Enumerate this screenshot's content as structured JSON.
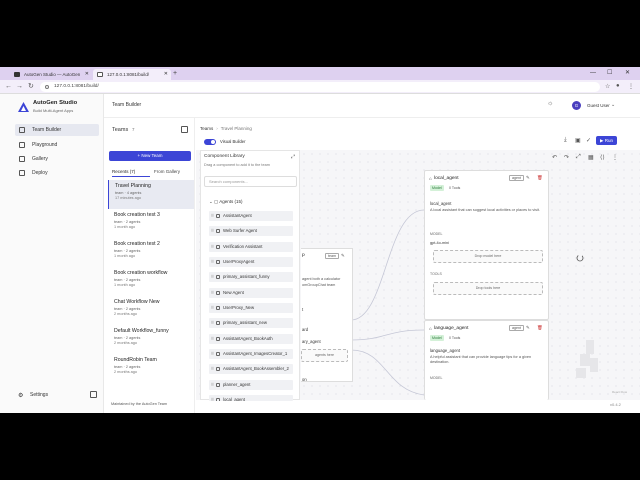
{
  "browser": {
    "tabs": [
      {
        "title": "AutoGen Studio — AutoGen",
        "active": false
      },
      {
        "title": "127.0.0.1:8081/build/",
        "active": true
      }
    ],
    "url": "127.0.0.1:8081/build/"
  },
  "brand": {
    "title": "AutoGen Studio",
    "subtitle": "Build Multi-Agent Apps"
  },
  "sidebar": {
    "items": [
      {
        "label": "Team Builder",
        "active": true
      },
      {
        "label": "Playground",
        "active": false
      },
      {
        "label": "Gallery",
        "active": false
      },
      {
        "label": "Deploy",
        "active": false
      }
    ],
    "settings_label": "Settings"
  },
  "header": {
    "title": "Team Builder",
    "user_name": "Guest User",
    "avatar_initial": "G"
  },
  "teams_panel": {
    "title": "Teams",
    "count": "7",
    "new_team_label": "+ New Team",
    "tab_recents": "Recents (7)",
    "tab_gallery": "From Gallery",
    "teams": [
      {
        "name": "Travel Planning",
        "meta": "team · 4 agents",
        "time": "17 minutes ago",
        "active": true
      },
      {
        "name": "Book creation test 3",
        "meta": "team · 2 agents",
        "time": "1 month ago",
        "active": false
      },
      {
        "name": "Book creation test 2",
        "meta": "team · 2 agents",
        "time": "1 month ago",
        "active": false
      },
      {
        "name": "Book creation workflow",
        "meta": "team · 2 agents",
        "time": "1 month ago",
        "active": false
      },
      {
        "name": "Chat Workflow New",
        "meta": "team · 2 agents",
        "time": "2 months ago",
        "active": false
      },
      {
        "name": "Default Workflow_funny",
        "meta": "team · 2 agents",
        "time": "2 months ago",
        "active": false
      },
      {
        "name": "RoundRobin Team",
        "meta": "team · 2 agents",
        "time": "2 months ago",
        "active": false
      }
    ]
  },
  "builder": {
    "crumb_root": "Teams",
    "crumb_current": "Travel Planning",
    "visual_builder_label": "Visual Builder",
    "run_label": "Run"
  },
  "library": {
    "title": "Component Library",
    "subtitle": "Drag a component to add it to the team",
    "search_placeholder": "Search components...",
    "agents_header": "Agents (15)",
    "agents": [
      "AssistantAgent",
      "Web Surfer Agent",
      "Verification Assistant",
      "UserProxyAgent",
      "primary_assistant_funny",
      "New Agent",
      "UserProxy_New",
      "primary_assistant_new",
      "AssistantAgent_BookAuth",
      "AssistantAgent_ImagesCreator_1",
      "AssistantAgent_BookAssembler_2",
      "planner_agent",
      "local_agent"
    ]
  },
  "nodes": {
    "partial": {
      "name_tail": "p",
      "type": "team",
      "desc": "agent both a calculator",
      "desc2": "omGroupChat team",
      "row1": "t",
      "row2": "ard",
      "row3": "ary_agent",
      "drop": "agents here",
      "row4": "on"
    },
    "local_agent": {
      "name": "local_agent",
      "type": "agent",
      "model_pill": "Model",
      "tools_pill": "0 Tools",
      "label": "local_agent",
      "desc": "A local assistant that can suggest local activities or places to visit.",
      "model_section": "MODEL",
      "model_name": "gpt-4o-mini",
      "drop_model": "Drop model here",
      "tools_section": "TOOLS",
      "drop_tools": "Drop tools here"
    },
    "language_agent": {
      "name": "language_agent",
      "type": "agent",
      "model_pill": "Model",
      "tools_pill": "0 Tools",
      "label": "language_agent",
      "desc": "A helpful assistant that can provide language tips for a given destination.",
      "model_section": "MODEL"
    }
  },
  "footer": {
    "text": "Maintained by the AutoGen Team",
    "version": "v0.4.2"
  },
  "react_flow_label": "React Flow",
  "colors": {
    "accent": "#3c45d6",
    "tabbar": "#ded1f0",
    "pill_green": "#d4f1d8"
  }
}
